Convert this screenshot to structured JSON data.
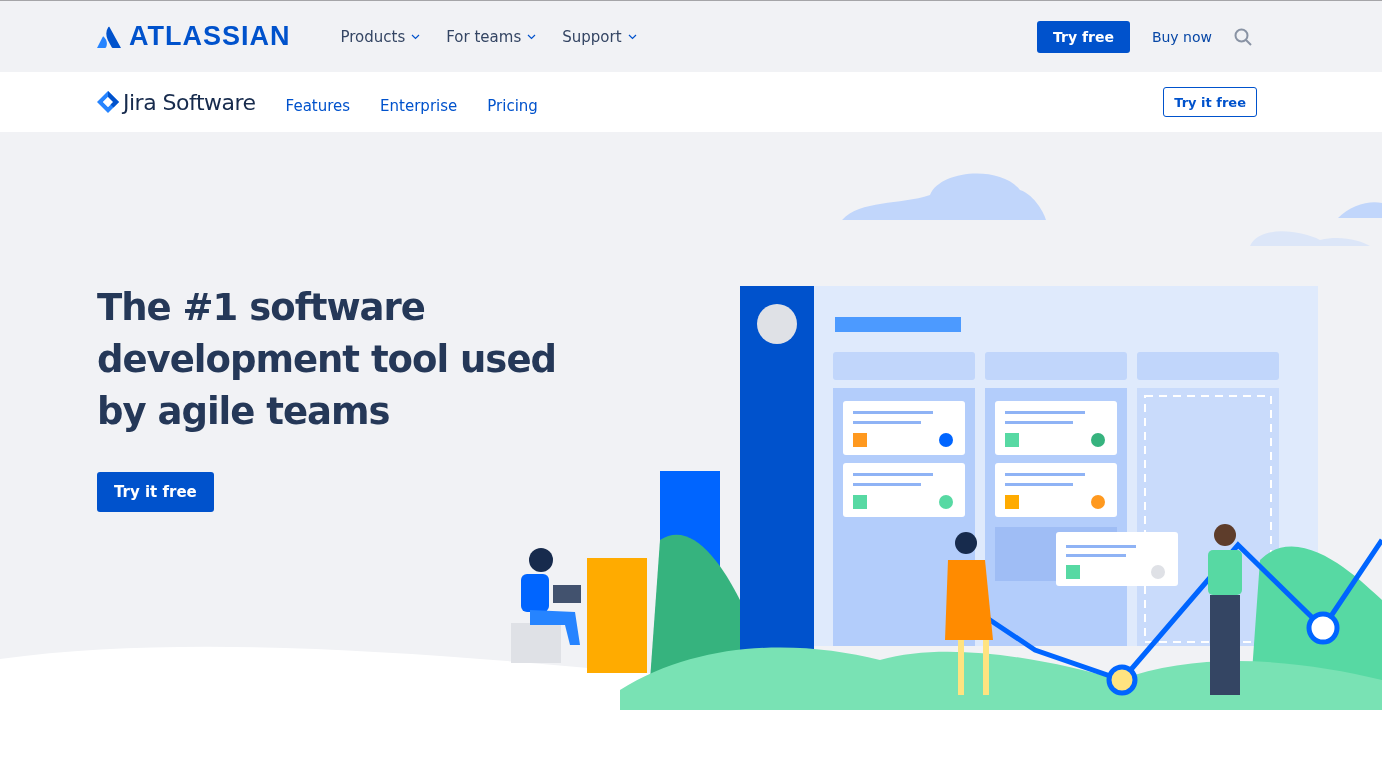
{
  "global_nav": {
    "brand": "ATLASSIAN",
    "menus": [
      {
        "label": "Products"
      },
      {
        "label": "For teams"
      },
      {
        "label": "Support"
      }
    ],
    "primary_button": "Try free",
    "link": "Buy now"
  },
  "product_nav": {
    "product": "Jira Software",
    "links": [
      {
        "label": "Features"
      },
      {
        "label": "Enterprise"
      },
      {
        "label": "Pricing"
      }
    ],
    "button": "Try it free"
  },
  "hero": {
    "heading": "The #1 software development tool used by agile teams",
    "button": "Try it free"
  }
}
